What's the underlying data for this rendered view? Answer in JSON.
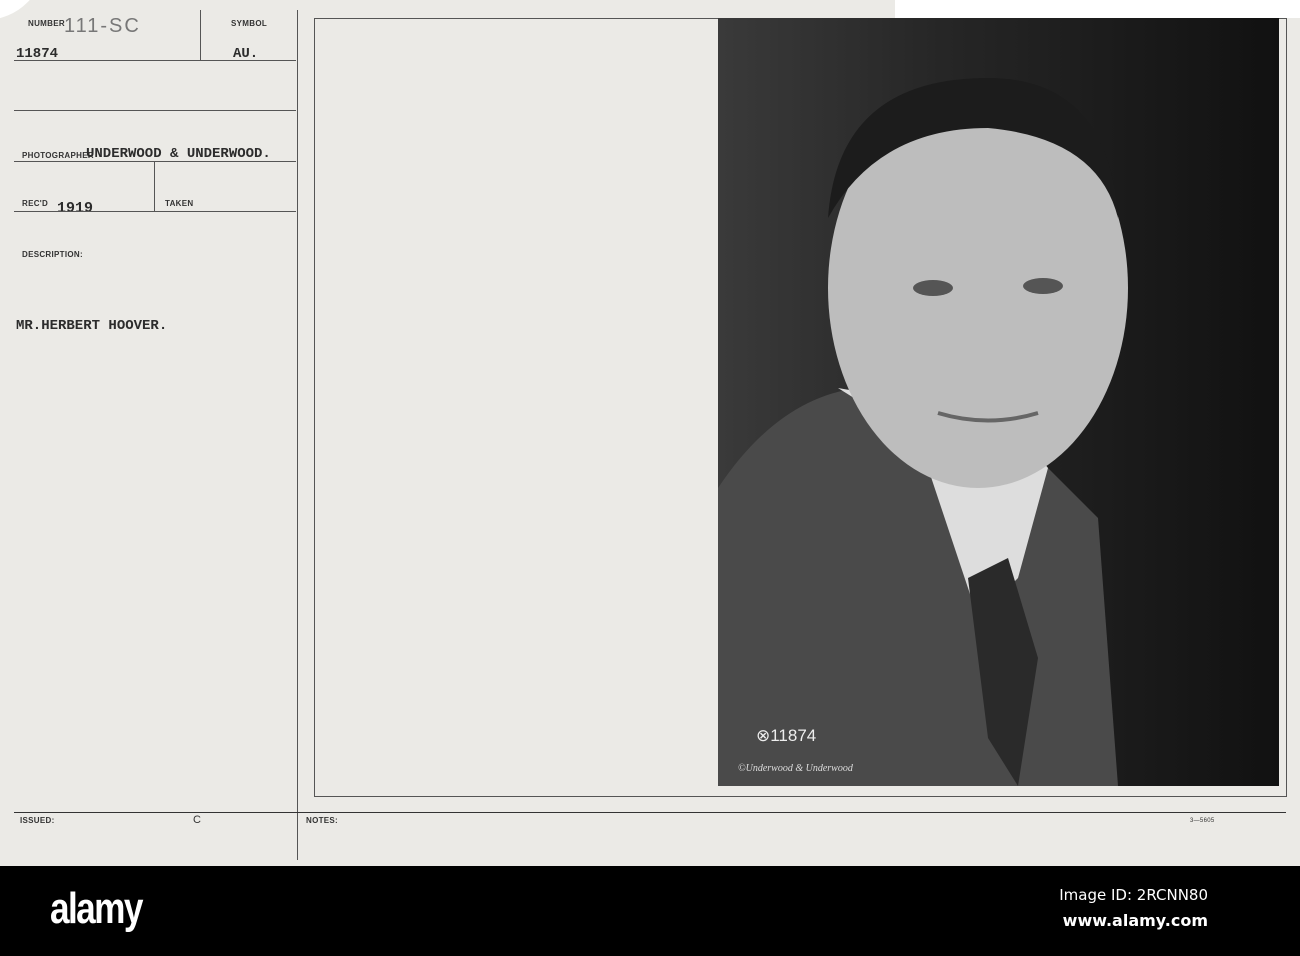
{
  "card": {
    "number_label": "NUMBER",
    "number_handwritten": "111-SC",
    "number_value": "11874",
    "symbol_label": "SYMBOL",
    "symbol_value": "AU.",
    "photographer_label": "PHOTOGRAPHER",
    "photographer_value": "UNDERWOOD & UNDERWOOD.",
    "recd_label": "REC'D",
    "recd_value": "1919",
    "taken_label": "TAKEN",
    "description_label": "DESCRIPTION:",
    "description_value": "MR.HERBERT HOOVER.",
    "issued_label": "ISSUED:",
    "issued_mark": "C",
    "notes_label": "NOTES:",
    "form_number": "3—5605"
  },
  "photo": {
    "negative_number": "⊗11874",
    "signature": "©Underwood & Underwood"
  },
  "footer": {
    "logo": "alamy",
    "image_id": "Image ID: 2RCNN80",
    "url": "www.alamy.com"
  }
}
